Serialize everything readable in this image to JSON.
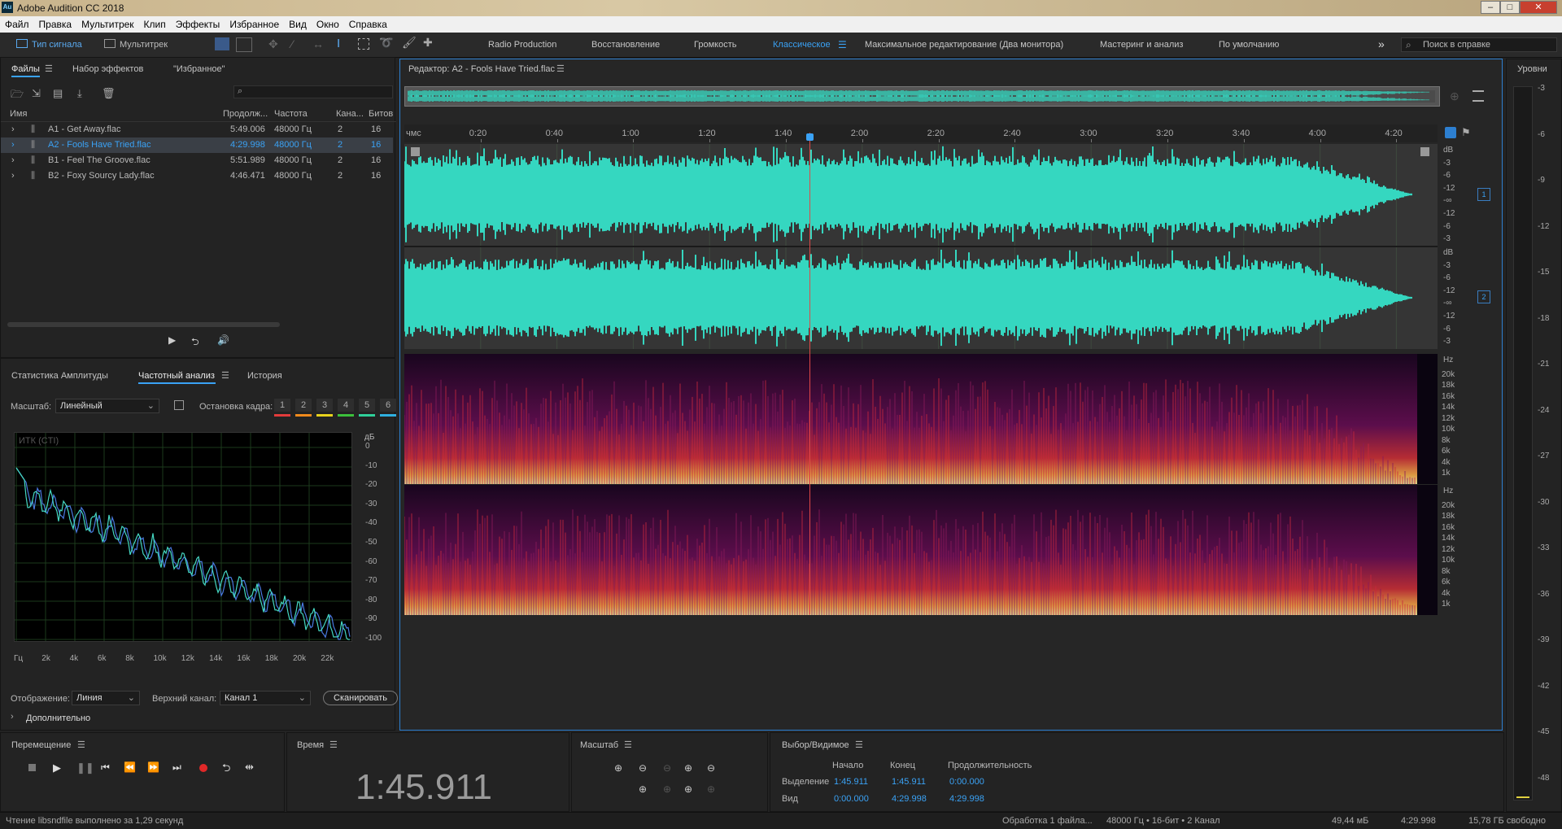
{
  "window": {
    "title": "Adobe Audition CC 2018",
    "logo": "Au"
  },
  "menu": [
    "Файл",
    "Правка",
    "Мультитрек",
    "Клип",
    "Эффекты",
    "Избранное",
    "Вид",
    "Окно",
    "Справка"
  ],
  "toolbar": {
    "waveform_label": "Тип сигнала",
    "multitrack_label": "Мультитрек",
    "workspaces": [
      "Radio Production",
      "Восстановление",
      "Громкость",
      "Классическое",
      "Максимальное редактирование (Два монитора)",
      "Мастеринг и анализ",
      "По умолчанию"
    ],
    "active_workspace": "Классическое",
    "search_placeholder": "Поиск в справке"
  },
  "files_panel": {
    "tabs": [
      "Файлы",
      "Набор эффектов",
      "\"Избранное\""
    ],
    "columns": [
      "Имя",
      "Продолж...",
      "Частота",
      "Кана...",
      "Битов"
    ],
    "rows": [
      {
        "name": "A1 - Get Away.flac",
        "duration": "5:49.006",
        "rate": "48000 Гц",
        "channels": "2",
        "bits": "16"
      },
      {
        "name": "A2 - Fools Have Tried.flac",
        "duration": "4:29.998",
        "rate": "48000 Гц",
        "channels": "2",
        "bits": "16",
        "selected": true
      },
      {
        "name": "B1 - Feel The Groove.flac",
        "duration": "5:51.989",
        "rate": "48000 Гц",
        "channels": "2",
        "bits": "16"
      },
      {
        "name": "B2 - Foxy Sourcy Lady.flac",
        "duration": "4:46.471",
        "rate": "48000 Гц",
        "channels": "2",
        "bits": "16"
      }
    ]
  },
  "analysis_panel": {
    "tabs": [
      "Статистика Амплитуды",
      "Частотный анализ",
      "История"
    ],
    "scale_label": "Масштаб:",
    "scale_value": "Линейный",
    "freeze_label": "Остановка кадра:",
    "freeze_slots": [
      "1",
      "2",
      "3",
      "4",
      "5",
      "6"
    ],
    "freeze_colors": [
      "#e23b3b",
      "#f08a1c",
      "#e8d21c",
      "#3bbf3b",
      "#2fcf9a",
      "#2fb0e0"
    ],
    "graph_label": "ИТК (CTI)",
    "db_unit": "дБ",
    "db_ticks": [
      "0",
      "-10",
      "-20",
      "-30",
      "-40",
      "-50",
      "-60",
      "-70",
      "-80",
      "-90",
      "-100"
    ],
    "freq_ticks": [
      "Гц",
      "2k",
      "4k",
      "6k",
      "8k",
      "10k",
      "12k",
      "14k",
      "16k",
      "18k",
      "20k",
      "22k"
    ],
    "display_label": "Отображение:",
    "display_value": "Линия",
    "channel_label": "Верхний канал:",
    "channel_value": "Канал 1",
    "scan_label": "Сканировать",
    "advanced_label": "Дополнительно"
  },
  "editor": {
    "title": "Редактор: A2 - Fools Have Tried.flac",
    "timeline_unit": "чмс",
    "time_ticks": [
      "0:20",
      "0:40",
      "1:00",
      "1:20",
      "1:40",
      "2:00",
      "2:20",
      "2:40",
      "3:00",
      "3:20",
      "3:40",
      "4:00",
      "4:20"
    ],
    "db_ticks": [
      "dB",
      "-3",
      "-6",
      "-12",
      "-∞",
      "-12",
      "-6",
      "-3"
    ],
    "channel_badges": [
      "1",
      "2"
    ],
    "hz_ticks": [
      "Hz",
      "20k",
      "18k",
      "16k",
      "14k",
      "12k",
      "10k",
      "8k",
      "6k",
      "4k",
      "1k"
    ],
    "playhead_fraction": 0.392
  },
  "levels_panel": {
    "title": "Уровни",
    "ticks": [
      "-3",
      "-6",
      "-9",
      "-12",
      "-15",
      "-18",
      "-21",
      "-24",
      "-27",
      "-30",
      "-33",
      "-36",
      "-39",
      "-42",
      "-45",
      "-48"
    ]
  },
  "transport": {
    "title": "Перемещение"
  },
  "time_panel": {
    "title": "Время",
    "value": "1:45.911"
  },
  "zoom_panel": {
    "title": "Масштаб"
  },
  "selection_panel": {
    "title": "Выбор/Видимое",
    "headers": [
      "Начало",
      "Конец",
      "Продолжительность"
    ],
    "rows": [
      {
        "label": "Выделение",
        "start": "1:45.911",
        "end": "1:45.911",
        "duration": "0:00.000"
      },
      {
        "label": "Вид",
        "start": "0:00.000",
        "end": "4:29.998",
        "duration": "4:29.998"
      }
    ]
  },
  "status": {
    "message": "Чтение libsndfile выполнено за 1,29 секунд",
    "processing": "Обработка 1 файла...",
    "format": "48000 Гц • 16-бит • 2 Канал",
    "size": "49,44 мБ",
    "duration": "4:29.998",
    "free": "15,78 ГБ свободно"
  },
  "colors": {
    "accent": "#2fa4ff",
    "waveform": "#35d7c0",
    "playhead": "#e04848"
  }
}
